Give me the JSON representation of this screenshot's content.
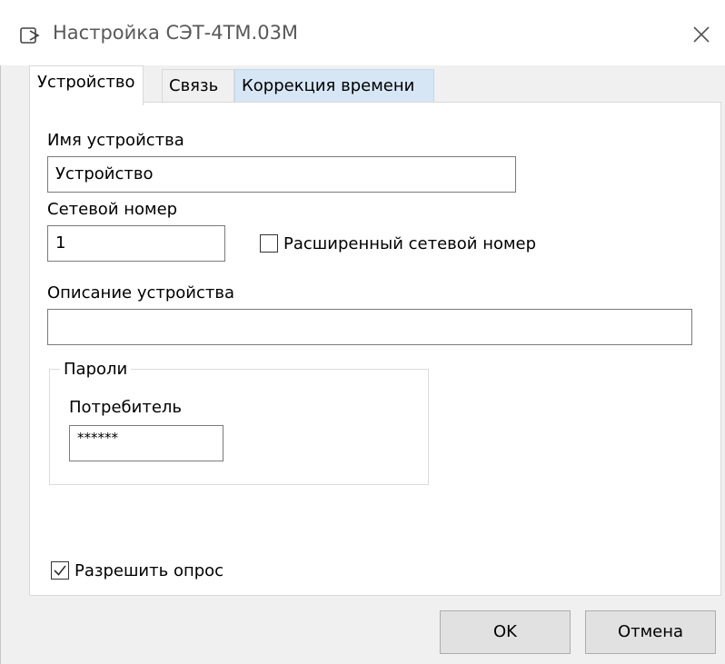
{
  "window": {
    "title": "Настройка СЭТ-4ТМ.03М",
    "icon": "window-icon",
    "close_icon": "close-icon"
  },
  "tabs": [
    {
      "label": "Устройство",
      "state": "selected"
    },
    {
      "label": "Связь",
      "state": "normal"
    },
    {
      "label": "Коррекция времени",
      "state": "hover"
    }
  ],
  "device": {
    "name_label": "Имя устройства",
    "name_value": "Устройство",
    "net_number_label": "Сетевой номер",
    "net_number_value": "1",
    "extended_label": "Расширенный сетевой номер",
    "extended_checked": false,
    "description_label": "Описание устройства",
    "description_value": ""
  },
  "passwords": {
    "group_title": "Пароли",
    "consumer_label": "Потребитель",
    "consumer_value": "******"
  },
  "poll": {
    "label": "Разрешить опрос",
    "checked": true
  },
  "buttons": {
    "ok": "OK",
    "cancel": "Отмена"
  },
  "colors": {
    "tab_hover_bg": "#d7e6f4",
    "dialog_bg": "#f0f0f0",
    "panel_bg": "#ffffff"
  }
}
